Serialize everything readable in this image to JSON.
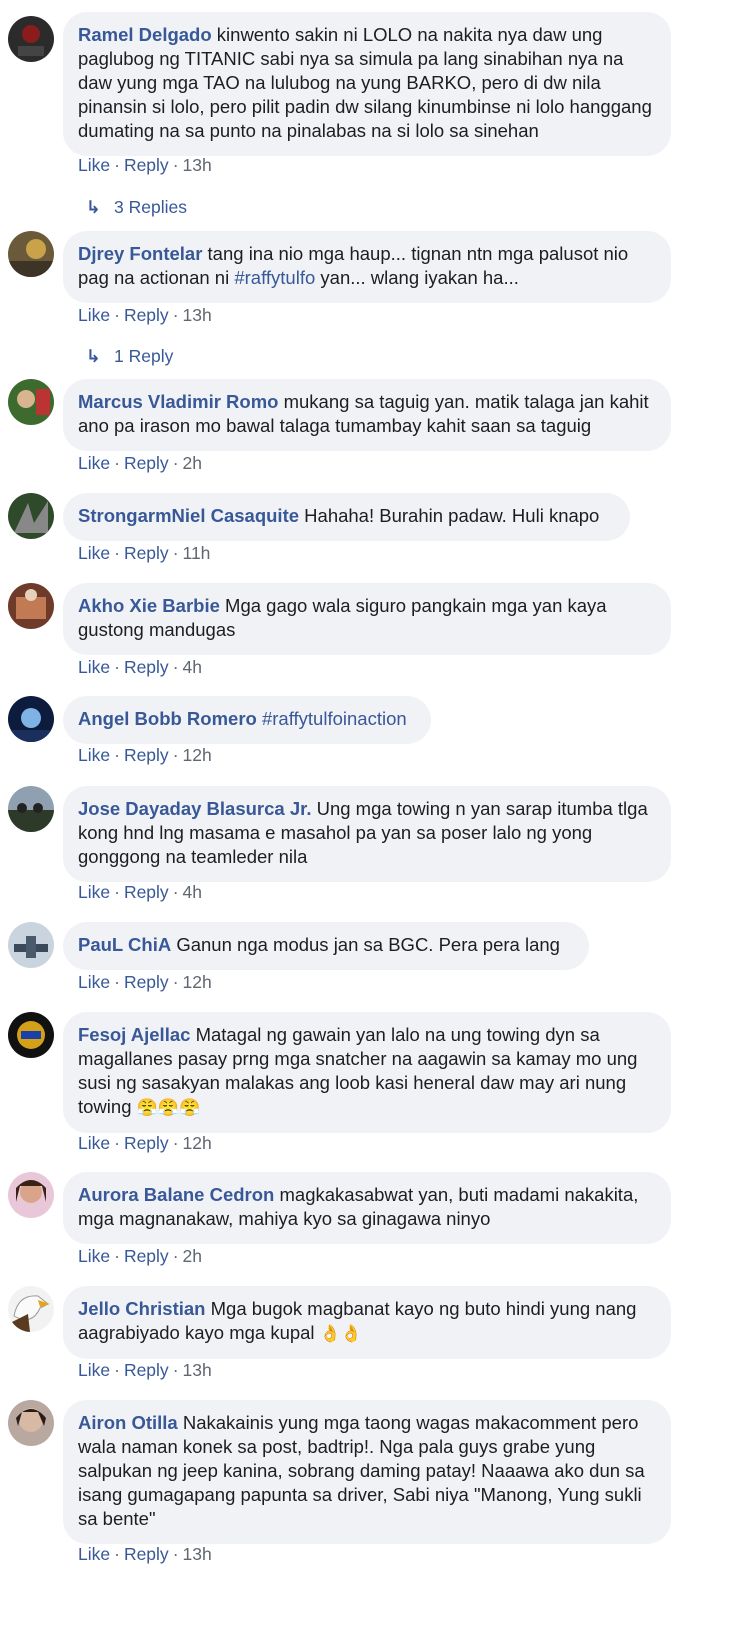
{
  "comments": [
    {
      "author": "Ramel Delgado",
      "text": "kinwento sakin ni LOLO na nakita nya daw ung paglubog ng TITANIC sabi nya sa simula pa lang sinabihan nya na daw yung mga TAO na lulubog na yung BARKO, pero di dw nila pinansin si lolo, pero pilit padin dw silang kinumbinse ni lolo hanggang dumating na sa punto na pinalabas na si lolo sa sinehan",
      "like": "Like",
      "reply": "Reply",
      "time": "13h",
      "replies": "3 Replies"
    },
    {
      "author": "Djrey Fontelar",
      "text_a": "tang ina nio mga haup... tignan ntn mga palusot nio pag na actionan ni ",
      "hashtag": "#raffytulfo",
      "text_b": " yan... wlang iyakan ha...",
      "like": "Like",
      "reply": "Reply",
      "time": "13h",
      "replies": "1 Reply"
    },
    {
      "author": "Marcus Vladimir Romo",
      "text": "mukang sa taguig yan. matik talaga jan kahit ano pa irason mo bawal talaga tumambay kahit saan sa taguig",
      "like": "Like",
      "reply": "Reply",
      "time": "2h"
    },
    {
      "author": "StrongarmNiel Casaquite",
      "text": "Hahaha! Burahin padaw. Huli knapo",
      "like": "Like",
      "reply": "Reply",
      "time": "11h"
    },
    {
      "author": "Akho Xie Barbie",
      "text": "Mga gago wala siguro pangkain mga yan kaya gustong mandugas",
      "like": "Like",
      "reply": "Reply",
      "time": "4h"
    },
    {
      "author": "Angel Bobb Romero",
      "hashtag": "#raffytulfoinaction",
      "like": "Like",
      "reply": "Reply",
      "time": "12h"
    },
    {
      "author": "Jose Dayaday Blasurca Jr.",
      "text": "Ung mga towing n yan sarap itumba tlga kong hnd lng masama e masahol pa yan sa poser lalo ng yong gonggong na teamleder nila",
      "like": "Like",
      "reply": "Reply",
      "time": "4h"
    },
    {
      "author": "PauL ChiA",
      "text": "Ganun nga modus jan sa BGC. Pera pera lang",
      "like": "Like",
      "reply": "Reply",
      "time": "12h"
    },
    {
      "author": "Fesoj Ajellac",
      "text": "Matagal ng gawain yan lalo na ung towing dyn sa magallanes pasay prng mga snatcher na aagawin sa kamay mo ung susi ng sasakyan malakas ang loob kasi heneral daw may ari nung towing",
      "emoji": "😤😤😤",
      "like": "Like",
      "reply": "Reply",
      "time": "12h"
    },
    {
      "author": "Aurora Balane Cedron",
      "text": "magkakasabwat yan, buti madami nakakita, mga magnanakaw, mahiya kyo sa ginagawa ninyo",
      "like": "Like",
      "reply": "Reply",
      "time": "2h"
    },
    {
      "author": "Jello Christian",
      "text": "Mga bugok magbanat kayo ng buto hindi yung nang aagrabiyado kayo mga kupal",
      "emoji": "👌👌",
      "like": "Like",
      "reply": "Reply",
      "time": "13h"
    },
    {
      "author": "Airon Otilla",
      "text": "Nakakainis yung mga taong wagas makacomment pero wala naman konek sa post, badtrip!. Nga pala guys grabe yung salpukan ng jeep kanina, sobrang daming patay! Naaawa ako dun sa isang gumagapang papunta sa driver, Sabi niya \"Manong, Yung sukli sa bente\"",
      "like": "Like",
      "reply": "Reply",
      "time": "13h"
    }
  ],
  "ui": {
    "separator": "·",
    "reply_arrow": "↳"
  }
}
